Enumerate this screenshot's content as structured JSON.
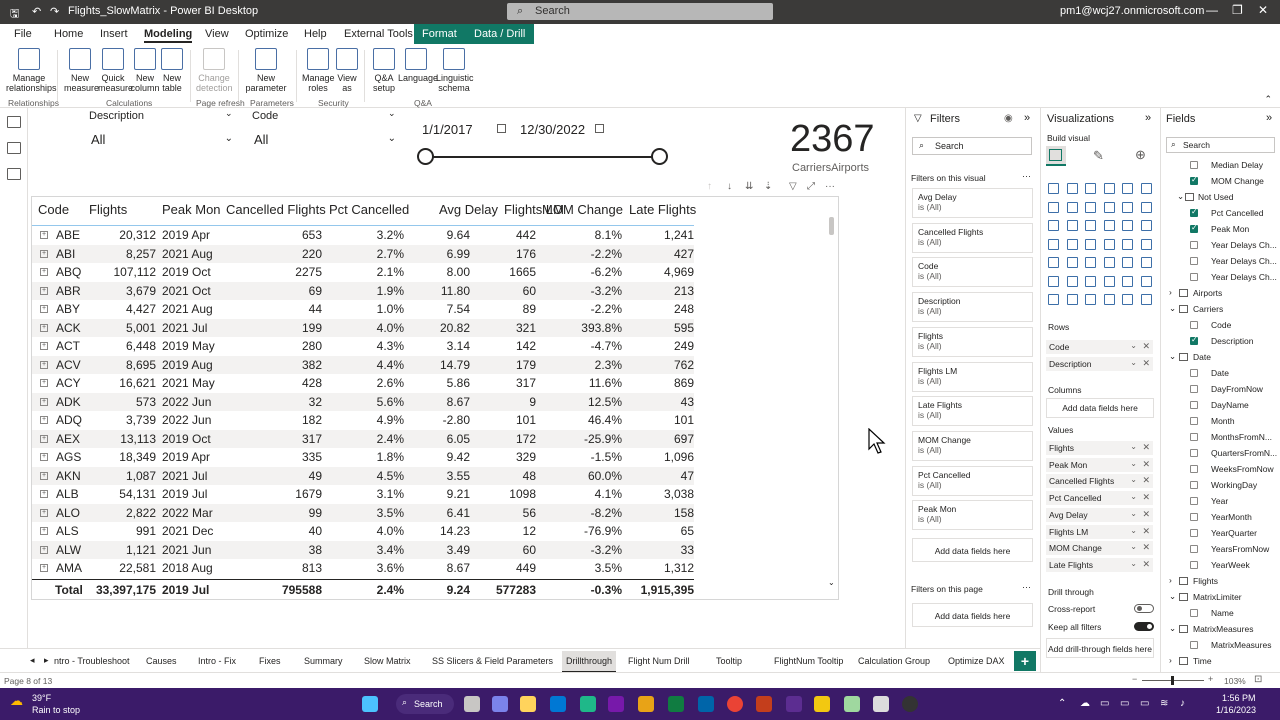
{
  "window": {
    "title": "Flights_SlowMatrix - Power BI Desktop",
    "search_placeholder": "Search",
    "user": "pm1@wcj27.onmicrosoft.com"
  },
  "menu": [
    "File",
    "Home",
    "Insert",
    "Modeling",
    "View",
    "Optimize",
    "Help",
    "External Tools",
    "Format",
    "Data / Drill"
  ],
  "ribbon": {
    "buttons": [
      "Manage relationships",
      "New measure",
      "Quick measure",
      "New column",
      "New table",
      "Change detection",
      "New parameter",
      "Manage roles",
      "View as",
      "Q&A setup",
      "Language",
      "Linguistic schema"
    ],
    "groups": [
      "Relationships",
      "Calculations",
      "Page refresh",
      "Parameters",
      "Security",
      "Q&A"
    ]
  },
  "slicers": {
    "description_label": "Description",
    "description_value": "All",
    "code_label": "Code",
    "code_value": "All",
    "date_start": "1/1/2017",
    "date_end": "12/30/2022"
  },
  "card": {
    "value": "2367",
    "label": "CarriersAirports"
  },
  "matrix": {
    "headers": [
      "Code",
      "Flights",
      "Peak Mon",
      "Cancelled Flights",
      "Pct Cancelled",
      "Avg Delay",
      "Flights LM",
      "MOM Change",
      "Late Flights"
    ],
    "rows": [
      [
        "ABE",
        "20,312",
        "2019 Apr",
        "653",
        "3.2%",
        "9.64",
        "442",
        "8.1%",
        "1,241"
      ],
      [
        "ABI",
        "8,257",
        "2021 Aug",
        "220",
        "2.7%",
        "6.99",
        "176",
        "-2.2%",
        "427"
      ],
      [
        "ABQ",
        "107,112",
        "2019 Oct",
        "2275",
        "2.1%",
        "8.00",
        "1665",
        "-6.2%",
        "4,969"
      ],
      [
        "ABR",
        "3,679",
        "2021 Oct",
        "69",
        "1.9%",
        "11.80",
        "60",
        "-3.2%",
        "213"
      ],
      [
        "ABY",
        "4,427",
        "2021 Aug",
        "44",
        "1.0%",
        "7.54",
        "89",
        "-2.2%",
        "248"
      ],
      [
        "ACK",
        "5,001",
        "2021 Jul",
        "199",
        "4.0%",
        "20.82",
        "321",
        "393.8%",
        "595"
      ],
      [
        "ACT",
        "6,448",
        "2019 May",
        "280",
        "4.3%",
        "3.14",
        "142",
        "-4.7%",
        "249"
      ],
      [
        "ACV",
        "8,695",
        "2019 Aug",
        "382",
        "4.4%",
        "14.79",
        "179",
        "2.3%",
        "762"
      ],
      [
        "ACY",
        "16,621",
        "2021 May",
        "428",
        "2.6%",
        "5.86",
        "317",
        "11.6%",
        "869"
      ],
      [
        "ADK",
        "573",
        "2022 Jun",
        "32",
        "5.6%",
        "8.67",
        "9",
        "12.5%",
        "43"
      ],
      [
        "ADQ",
        "3,739",
        "2022 Jun",
        "182",
        "4.9%",
        "-2.80",
        "101",
        "46.4%",
        "101"
      ],
      [
        "AEX",
        "13,113",
        "2019 Oct",
        "317",
        "2.4%",
        "6.05",
        "172",
        "-25.9%",
        "697"
      ],
      [
        "AGS",
        "18,349",
        "2019 Apr",
        "335",
        "1.8%",
        "9.42",
        "329",
        "-1.5%",
        "1,096"
      ],
      [
        "AKN",
        "1,087",
        "2021 Jul",
        "49",
        "4.5%",
        "3.55",
        "48",
        "60.0%",
        "47"
      ],
      [
        "ALB",
        "54,131",
        "2019 Jul",
        "1679",
        "3.1%",
        "9.21",
        "1098",
        "4.1%",
        "3,038"
      ],
      [
        "ALO",
        "2,822",
        "2022 Mar",
        "99",
        "3.5%",
        "6.41",
        "56",
        "-8.2%",
        "158"
      ],
      [
        "ALS",
        "991",
        "2021 Dec",
        "40",
        "4.0%",
        "14.23",
        "12",
        "-76.9%",
        "65"
      ],
      [
        "ALW",
        "1,121",
        "2021 Jun",
        "38",
        "3.4%",
        "3.49",
        "60",
        "-3.2%",
        "33"
      ],
      [
        "AMA",
        "22,581",
        "2018 Aug",
        "813",
        "3.6%",
        "8.67",
        "449",
        "3.5%",
        "1,312"
      ]
    ],
    "total": [
      "Total",
      "33,397,175",
      "2019 Jul",
      "795588",
      "2.4%",
      "9.24",
      "577283",
      "-0.3%",
      "1,915,395"
    ]
  },
  "filters": {
    "title": "Filters",
    "search": "Search",
    "section_visual": "Filters on this visual",
    "section_page": "Filters on this page",
    "cards": [
      {
        "name": "Avg Delay",
        "value": "is (All)"
      },
      {
        "name": "Cancelled Flights",
        "value": "is (All)"
      },
      {
        "name": "Code",
        "value": "is (All)"
      },
      {
        "name": "Description",
        "value": "is (All)"
      },
      {
        "name": "Flights",
        "value": "is (All)"
      },
      {
        "name": "Flights LM",
        "value": "is (All)"
      },
      {
        "name": "Late Flights",
        "value": "is (All)"
      },
      {
        "name": "MOM Change",
        "value": "is (All)"
      },
      {
        "name": "Pct Cancelled",
        "value": "is (All)"
      },
      {
        "name": "Peak Mon",
        "value": "is (All)"
      }
    ],
    "add_fields": "Add data fields here"
  },
  "visualizations": {
    "title": "Visualizations",
    "build_visual": "Build visual",
    "rows_label": "Rows",
    "rows": [
      "Code",
      "Description"
    ],
    "columns_label": "Columns",
    "columns_add": "Add data fields here",
    "values_label": "Values",
    "values": [
      "Flights",
      "Peak Mon",
      "Cancelled Flights",
      "Pct Cancelled",
      "Avg Delay",
      "Flights LM",
      "MOM Change",
      "Late Flights"
    ],
    "drill_title": "Drill through",
    "cross_report": "Cross-report",
    "cross_state": "Off",
    "keep_filters": "Keep all filters",
    "keep_state": "On",
    "drill_add": "Add drill-through fields here"
  },
  "fields": {
    "title": "Fields",
    "search": "Search",
    "items": [
      {
        "label": "Median Delay",
        "kind": "field",
        "checked": false
      },
      {
        "label": "MOM Change",
        "kind": "field",
        "checked": true
      },
      {
        "label": "Not Used",
        "kind": "folder",
        "checked": false
      },
      {
        "label": "Pct Cancelled",
        "kind": "field",
        "checked": true
      },
      {
        "label": "Peak Mon",
        "kind": "field",
        "checked": true
      },
      {
        "label": "Year Delays Ch...",
        "kind": "field",
        "checked": false
      },
      {
        "label": "Year Delays Ch...",
        "kind": "field",
        "checked": false
      },
      {
        "label": "Year Delays Ch...",
        "kind": "field",
        "checked": false
      },
      {
        "label": "Airports",
        "kind": "table",
        "checked": false
      },
      {
        "label": "Carriers",
        "kind": "table",
        "checked": false
      },
      {
        "label": "Code",
        "kind": "field",
        "checked": false
      },
      {
        "label": "Description",
        "kind": "field",
        "checked": true
      },
      {
        "label": "Date",
        "kind": "table",
        "checked": false
      },
      {
        "label": "Date",
        "kind": "field",
        "checked": false
      },
      {
        "label": "DayFromNow",
        "kind": "field",
        "checked": false
      },
      {
        "label": "DayName",
        "kind": "field",
        "checked": false
      },
      {
        "label": "Month",
        "kind": "field",
        "checked": false
      },
      {
        "label": "MonthsFromN...",
        "kind": "field",
        "checked": false
      },
      {
        "label": "QuartersFromN...",
        "kind": "field",
        "checked": false
      },
      {
        "label": "WeeksFromNow",
        "kind": "field",
        "checked": false
      },
      {
        "label": "WorkingDay",
        "kind": "field",
        "checked": false
      },
      {
        "label": "Year",
        "kind": "field",
        "checked": false
      },
      {
        "label": "YearMonth",
        "kind": "field",
        "checked": false
      },
      {
        "label": "YearQuarter",
        "kind": "field",
        "checked": false
      },
      {
        "label": "YearsFromNow",
        "kind": "field",
        "checked": false
      },
      {
        "label": "YearWeek",
        "kind": "field",
        "checked": false
      },
      {
        "label": "Flights",
        "kind": "table",
        "checked": false
      },
      {
        "label": "MatrixLimiter",
        "kind": "table",
        "checked": false
      },
      {
        "label": "Name",
        "kind": "field",
        "checked": false
      },
      {
        "label": "MatrixMeasures",
        "kind": "table",
        "checked": false
      },
      {
        "label": "MatrixMeasures",
        "kind": "field",
        "checked": false
      },
      {
        "label": "Time",
        "kind": "table",
        "checked": false
      }
    ]
  },
  "page_tabs": [
    "ntro - Troubleshoot",
    "Causes",
    "Intro - Fix",
    "Fixes",
    "Summary",
    "Slow Matrix",
    "SS Slicers & Field Parameters",
    "Drillthrough",
    "Flight Num Drill",
    "Tooltip",
    "FlightNum Tooltip",
    "Calculation Group",
    "Optimize DAX"
  ],
  "active_tab": "Drillthrough",
  "status": {
    "page": "Page 8 of 13",
    "zoom": "103%"
  },
  "taskbar": {
    "weather_temp": "39°F",
    "weather_text": "Rain to stop",
    "search": "Search",
    "time": "1:56 PM",
    "date": "1/16/2023"
  }
}
